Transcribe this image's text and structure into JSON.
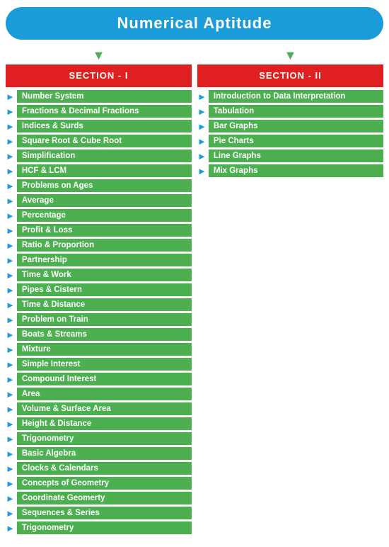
{
  "title": "Numerical Aptitude",
  "section1": {
    "header": "SECTION - I",
    "items": [
      "Number System",
      "Fractions & Decimal Fractions",
      "Indices & Surds",
      "Square Root & Cube Root",
      "Simplification",
      "HCF & LCM",
      "Problems on Ages",
      "Average",
      "Percentage",
      "Profit & Loss",
      "Ratio & Proportion",
      "Partnership",
      "Time & Work",
      "Pipes & Cistern",
      "Time & Distance",
      "Problem on Train",
      "Boats & Streams",
      "Mixture",
      "Simple Interest",
      "Compound Interest",
      "Area",
      "Volume & Surface Area",
      "Height & Distance",
      "Trigonometry",
      "Basic Algebra",
      "Clocks & Calendars",
      "Concepts of Geometry",
      "Coordinate Geomerty",
      "Sequences & Series",
      "Trigonometry"
    ]
  },
  "section2": {
    "header": "SECTION - II",
    "items": [
      "Introduction to Data Interpretation",
      "Tabulation",
      "Bar Graphs",
      "Pie Charts",
      "Line Graphs",
      "Mix Graphs"
    ]
  },
  "arrow": "▼"
}
